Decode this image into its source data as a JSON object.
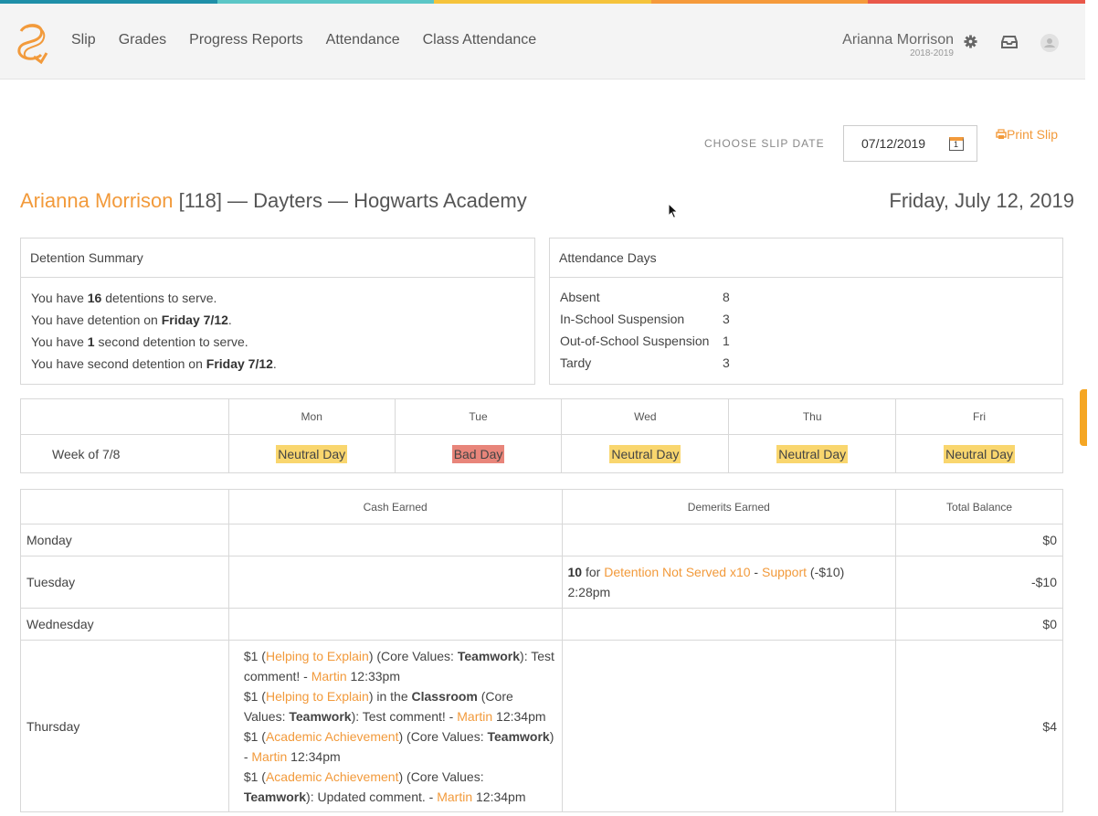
{
  "stripe_colors": [
    "#1f8fa8",
    "#5bc6c6",
    "#f5c33b",
    "#f59a3b",
    "#e9584a"
  ],
  "accent": "#f29a3b",
  "nav": {
    "items": [
      "Slip",
      "Grades",
      "Progress Reports",
      "Attendance",
      "Class Attendance"
    ],
    "user_name": "Arianna Morrison",
    "school_year": "2018-2019"
  },
  "slip": {
    "choose_label": "CHOOSE SLIP DATE",
    "date_value": "07/12/2019",
    "calendar_day": "1",
    "print_label": "Print Slip",
    "student_name": "Arianna Morrison",
    "student_rest": " [118] — Dayters — Hogwarts Academy",
    "date_heading": "Friday, July 12, 2019"
  },
  "detention": {
    "title": "Detention Summary",
    "lines": [
      {
        "pre": "You have ",
        "bold": "16",
        "post": " detentions to serve."
      },
      {
        "pre": "You have detention on ",
        "bold": "Friday 7/12",
        "post": "."
      },
      {
        "pre": "You have ",
        "bold": "1",
        "post": " second detention to serve."
      },
      {
        "pre": "You have second detention on ",
        "bold": "Friday 7/12",
        "post": "."
      }
    ]
  },
  "attendance": {
    "title": "Attendance Days",
    "rows": [
      {
        "label": "Absent",
        "value": "8"
      },
      {
        "label": "In-School Suspension",
        "value": "3"
      },
      {
        "label": "Out-of-School Suspension",
        "value": "1"
      },
      {
        "label": "Tardy",
        "value": "3"
      }
    ]
  },
  "week": {
    "days": [
      "Mon",
      "Tue",
      "Wed",
      "Thu",
      "Fri"
    ],
    "label": "Week of 7/8",
    "statuses": [
      "Neutral Day",
      "Bad Day",
      "Neutral Day",
      "Neutral Day",
      "Neutral Day"
    ]
  },
  "cash": {
    "headers": [
      "Cash Earned",
      "Demerits Earned",
      "Total Balance"
    ],
    "monday": {
      "label": "Monday",
      "balance": "$0"
    },
    "tuesday": {
      "label": "Tuesday",
      "balance": "-$10",
      "dem_count": "10",
      "dem_for": " for ",
      "dem_reason": "Detention Not Served x10",
      "dem_dash": " - ",
      "dem_staff": "Support",
      "dem_amount": " (-$10)",
      "dem_time": "2:28pm"
    },
    "wednesday": {
      "label": "Wednesday",
      "balance": "$0"
    },
    "thursday": {
      "label": "Thursday",
      "balance": "$4",
      "entries": [
        {
          "amt": "$1",
          "reason": "Helping to Explain",
          "mid": ") (Core Values: ",
          "value": "Teamwork",
          "tail": "): Test comment! - ",
          "staff": "Martin",
          "time": " 12:33pm"
        },
        {
          "amt": "$1",
          "reason": "Helping to Explain",
          "mid": ") in the ",
          "value": "Classroom",
          "tail": " (Core Values: ",
          "value2": "Teamwork",
          "tail2": "): Test comment! - ",
          "staff": "Martin",
          "time": " 12:34pm"
        },
        {
          "amt": "$1",
          "reason": "Academic Achievement",
          "mid": ") (Core Values: ",
          "value": "Teamwork",
          "tail": ") - ",
          "staff": "Martin",
          "time": " 12:34pm"
        },
        {
          "amt": "$1",
          "reason": "Academic Achievement",
          "mid": ") (Core Values: ",
          "value": "Teamwork",
          "tail": "): Updated comment. - ",
          "staff": "Martin",
          "time": " 12:34pm"
        }
      ]
    }
  }
}
